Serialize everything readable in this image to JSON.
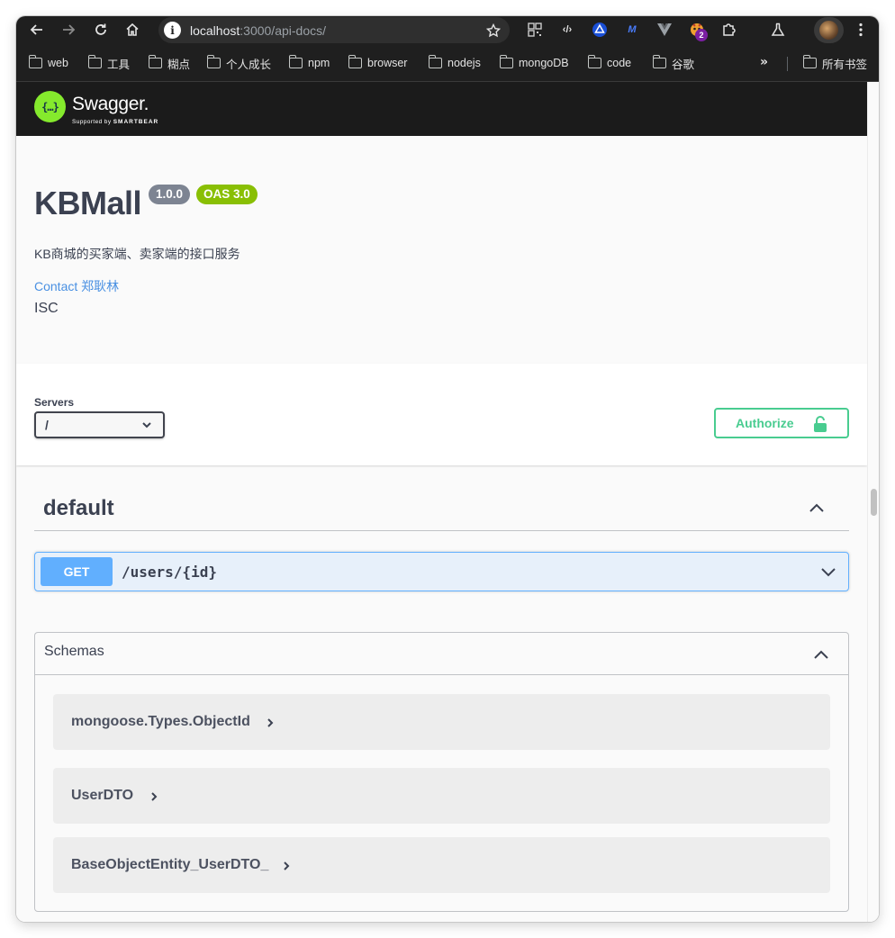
{
  "browser": {
    "url_host": "localhost",
    "url_path": ":3000/api-docs/",
    "extension_badge": "2"
  },
  "bookmarks": {
    "items": [
      "web",
      "工具",
      "糊点",
      "个人成长",
      "npm",
      "browser",
      "nodejs",
      "mongoDB",
      "code",
      "谷歌"
    ],
    "more": "»",
    "all_bookmarks": "所有书签"
  },
  "swagger": {
    "brand": "Swagger.",
    "supported_by": "Supported by",
    "smartbear": "SMARTBEAR",
    "logo_glyph": "{…}"
  },
  "info": {
    "title": "KBMall",
    "version": "1.0.0",
    "oas": "OAS 3.0",
    "description": "KB商城的买家端、卖家端的接口服务",
    "contact": "Contact 郑耿林",
    "license": "ISC"
  },
  "scheme": {
    "servers_label": "Servers",
    "selected_server": "/",
    "authorize_label": "Authorize"
  },
  "tag": {
    "name": "default"
  },
  "operations": [
    {
      "method": "GET",
      "path": "/users/{id}",
      "color": "#61affe"
    }
  ],
  "schemas": {
    "title": "Schemas",
    "items": [
      "mongoose.Types.ObjectId",
      "UserDTO",
      "BaseObjectEntity_UserDTO_"
    ]
  },
  "colors": {
    "get": "#61affe",
    "authorize": "#49cc90",
    "oas_badge": "#89bf04",
    "version_badge": "#7d8492",
    "link": "#4990e2",
    "logo": "#85ea2d"
  }
}
